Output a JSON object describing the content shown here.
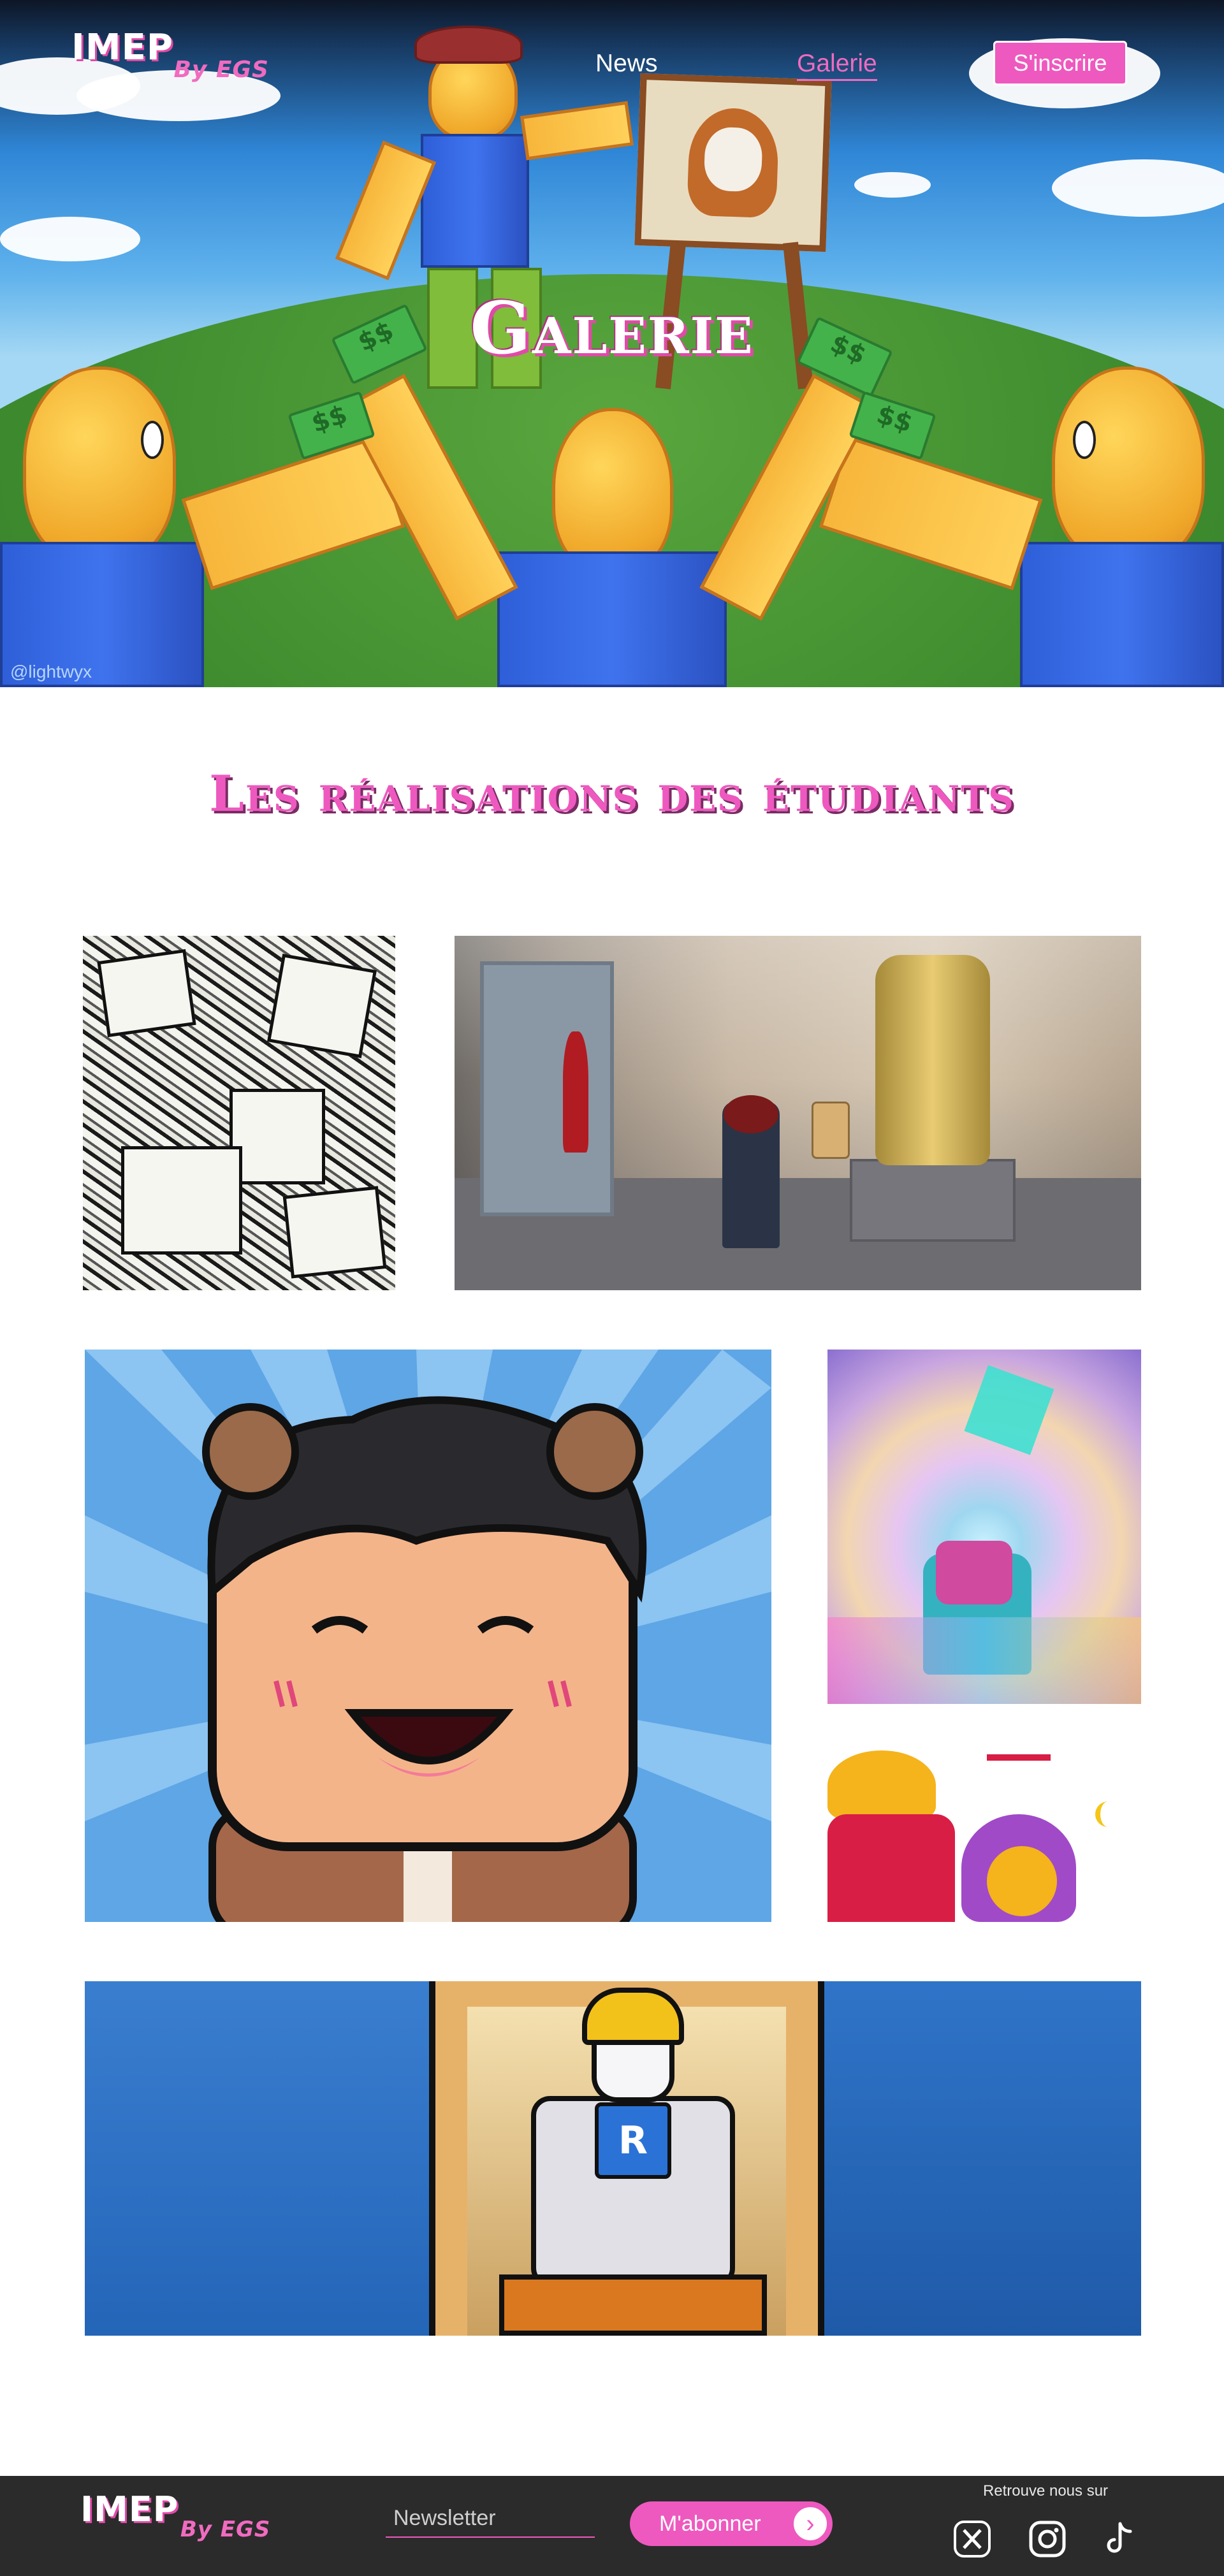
{
  "brand": {
    "logo_main": "IMEP",
    "logo_sub": "By EGS"
  },
  "nav": {
    "items": [
      {
        "label": "News",
        "active": false
      },
      {
        "label": "Galerie",
        "active": true
      }
    ],
    "signup_label": "S'inscrire"
  },
  "hero": {
    "title": "Galerie",
    "credit": "@lightwyx"
  },
  "gallery": {
    "title": "Les réalisations des étudiants",
    "items": [
      {
        "name": "manga-style-drawing"
      },
      {
        "name": "museum-3d-scene"
      },
      {
        "name": "avatar-portrait"
      },
      {
        "name": "crystal-fantasy-scene"
      },
      {
        "name": "comic-characters"
      },
      {
        "name": "builder-character"
      }
    ]
  },
  "footer": {
    "newsletter_placeholder": "Newsletter",
    "subscribe_label": "M'abonner",
    "follow_label": "Retrouve nous sur",
    "socials": [
      "x-icon",
      "instagram-icon",
      "tiktok-icon"
    ]
  },
  "colors": {
    "accent": "#ee59bf",
    "footer_bg": "#2b2b2b"
  }
}
